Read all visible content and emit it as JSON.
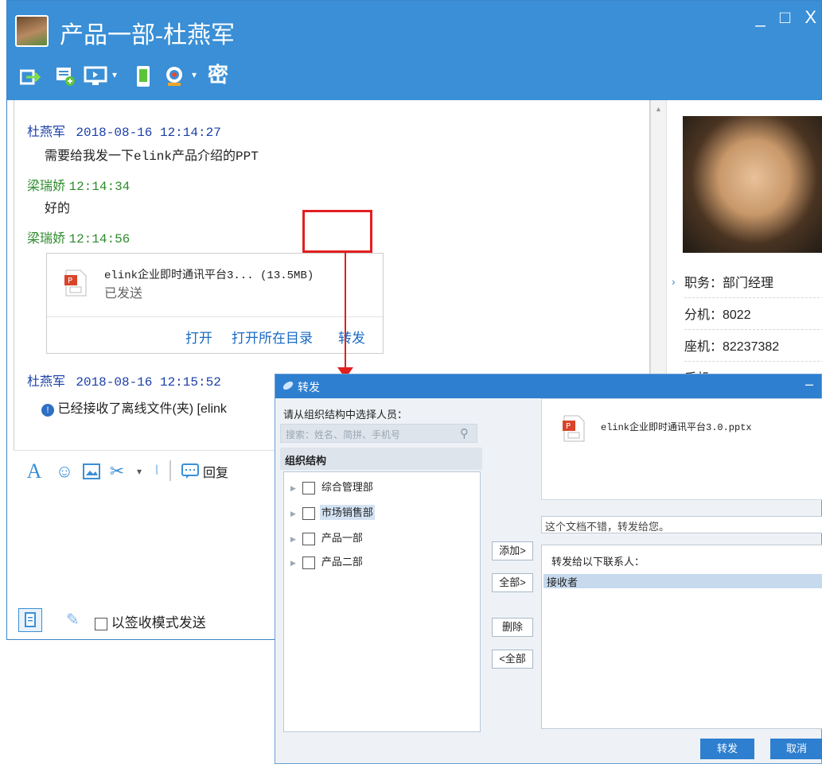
{
  "window": {
    "title": "产品一部-杜燕军",
    "controls": [
      "_",
      "□",
      "X"
    ]
  },
  "toolbar": {
    "icons": [
      "transfer-file-icon",
      "send-file-icon",
      "remote-desktop-icon",
      "mobile-icon",
      "video-icon",
      "secret-icon"
    ],
    "secret_label": "密"
  },
  "messages": [
    {
      "sender": "杜燕军",
      "time": "2018-08-16 12:14:27",
      "text": "需要给我发一下elink产品介绍的PPT"
    },
    {
      "sender": "梁瑞娇",
      "time": "12:14:34",
      "text": "好的"
    },
    {
      "sender": "梁瑞娇",
      "time": "12:14:56"
    },
    {
      "sender": "杜燕军",
      "time": "2018-08-16 12:15:52",
      "text": "已经接收了离线文件(夹) [elink"
    }
  ],
  "file_card": {
    "name": "elink企业即时通讯平台3...",
    "size": "(13.5MB)",
    "status": "已发送",
    "actions": {
      "open": "打开",
      "open_folder": "打开所在目录",
      "forward": "转发"
    }
  },
  "profile": {
    "position_label": "职务：部门经理",
    "ext_label": "分机：8022",
    "landline_label": "座机：82237382",
    "mobile_label": "手机："
  },
  "input_toolbar": {
    "reply_label": "回复"
  },
  "bottom_bar": {
    "sign_mode_label": "以签收模式发送"
  },
  "dialog": {
    "title": "转发",
    "minimize": "–",
    "prompt": "请从组织结构中选择人员：",
    "search_placeholder": "搜索：姓名、简拼、手机号",
    "org_header": "组织结构",
    "tree": [
      "综合管理部",
      "市场销售部",
      "产品一部",
      "产品二部"
    ],
    "buttons": {
      "add": "添加>",
      "all": "全部>",
      "delete": "删除",
      "remove_all": "<全部"
    },
    "file_name": "elink企业即时通讯平台3.0.pptx",
    "message": "这个文档不错，转发给您。",
    "recipients_title": "转发给以下联系人：",
    "recipients_header": "接收者",
    "ok": "转发",
    "cancel": "取消"
  },
  "colors": {
    "title_blue": "#3a8fd6",
    "highlight_red": "#e21f1f",
    "link_blue": "#1a6bc4"
  }
}
